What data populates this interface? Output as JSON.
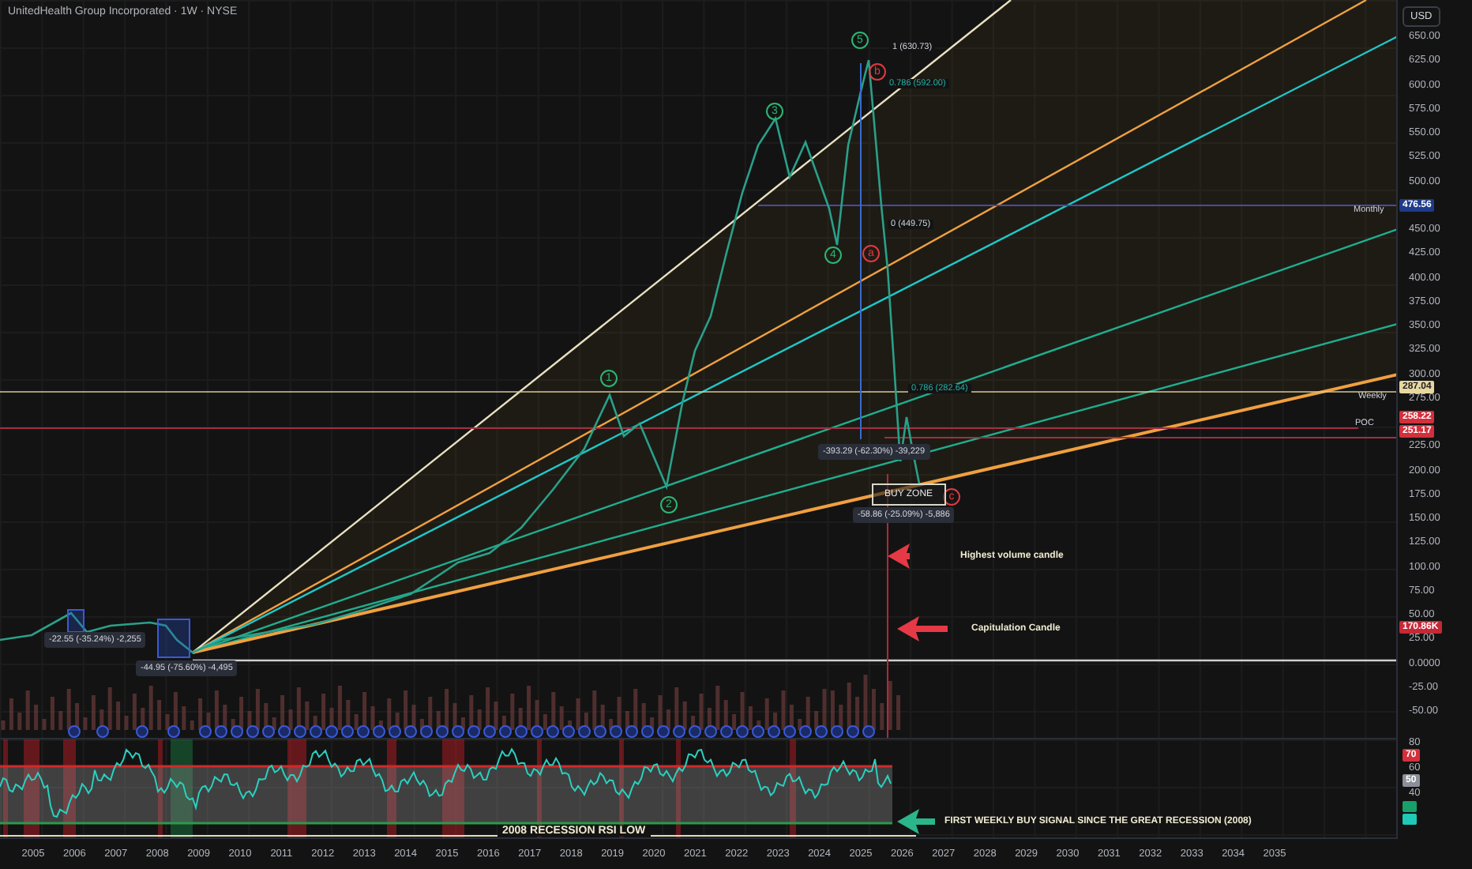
{
  "title": "UnitedHealth Group Incorporated · 1W · NYSE",
  "currency": "USD",
  "price_axis": [
    "650.00",
    "625.00",
    "600.00",
    "575.00",
    "550.00",
    "525.00",
    "500.00",
    "450.00",
    "425.00",
    "400.00",
    "375.00",
    "350.00",
    "325.00",
    "300.00",
    "275.00",
    "225.00",
    "200.00",
    "175.00",
    "150.00",
    "125.00",
    "100.00",
    "75.00",
    "50.00",
    "25.00",
    "0.0000",
    "-25.00",
    "-50.00"
  ],
  "price_tags": [
    {
      "text": "476.56",
      "color": "#1e3a8a"
    },
    {
      "text": "287.04",
      "color": "#e8d8a0"
    },
    {
      "text": "258.22",
      "color": "#d32f3c"
    },
    {
      "text": "251.17",
      "color": "#d32f3c"
    },
    {
      "text": "170.86K",
      "color": "#c62835"
    }
  ],
  "line_labels": [
    "Monthly",
    "Weekly",
    "POC"
  ],
  "waves": [
    {
      "text": "1",
      "color": "#2bb673"
    },
    {
      "text": "2",
      "color": "#2bb673"
    },
    {
      "text": "3",
      "color": "#2bb673"
    },
    {
      "text": "4",
      "color": "#2bb673"
    },
    {
      "text": "5",
      "color": "#2bb673"
    },
    {
      "text": "b",
      "color": "#e0393e"
    },
    {
      "text": "a",
      "color": "#e0393e"
    },
    {
      "text": "c",
      "color": "#e0393e"
    }
  ],
  "fib_levels": [
    "1 (630.73)",
    "0.786 (592.00)",
    "0 (449.75)",
    "0.786 (282.64)"
  ],
  "measurements": [
    "-22.55 (-35.24%) -2,255",
    "-44.95 (-75.60%) -4,495",
    "-393.29 (-62.30%) -39,229",
    "-58.86 (-25.09%) -5,886"
  ],
  "buy_zone": "BUY ZONE",
  "callouts": [
    {
      "text": "Highest volume candle",
      "color": "#e53945"
    },
    {
      "text": "Capitulation Candle",
      "color": "#e53945"
    },
    {
      "text": "FIRST WEEKLY BUY SIGNAL SINCE THE GREAT RECESSION (2008)",
      "color": "#2bb58a"
    }
  ],
  "rsi_note": "2008 RECESSION RSI LOW",
  "rsi_axis": [
    "80",
    "60",
    "40"
  ],
  "rsi_tags": [
    {
      "text": "70",
      "color": "#d32f3c"
    },
    {
      "text": "50",
      "color": "#8a8f98"
    }
  ],
  "years": [
    "2005",
    "2006",
    "2007",
    "2008",
    "2009",
    "2010",
    "2011",
    "2012",
    "2013",
    "2014",
    "2015",
    "2016",
    "2017",
    "2018",
    "2019",
    "2020",
    "2021",
    "2022",
    "2023",
    "2024",
    "2025",
    "2026",
    "2027",
    "2028",
    "2029",
    "2030",
    "2031",
    "2032",
    "2033",
    "2034",
    "2035"
  ]
}
